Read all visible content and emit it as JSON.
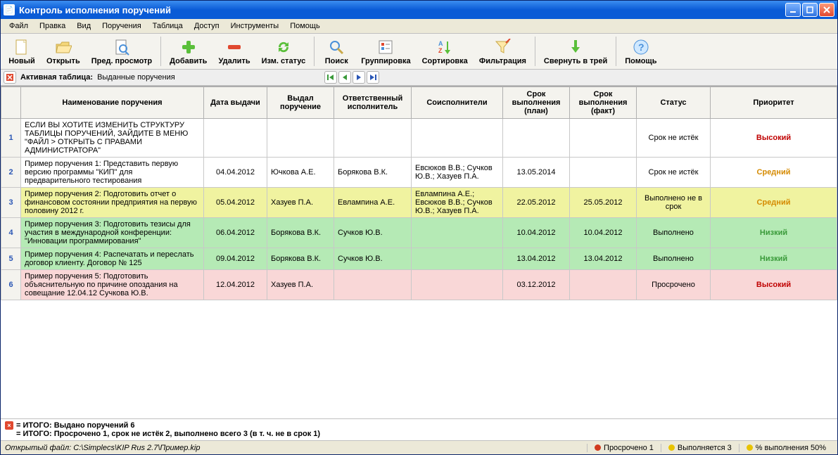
{
  "window": {
    "title": "Контроль исполнения поручений"
  },
  "menu": {
    "file": "Файл",
    "edit": "Правка",
    "view": "Вид",
    "tasks": "Поручения",
    "table": "Таблица",
    "access": "Доступ",
    "tools": "Инструменты",
    "help": "Помощь"
  },
  "toolbar": {
    "new": "Новый",
    "open": "Открыть",
    "preview": "Пред. просмотр",
    "add": "Добавить",
    "delete": "Удалить",
    "status": "Изм. статус",
    "search": "Поиск",
    "group": "Группировка",
    "sort": "Сортировка",
    "filter": "Фильтрация",
    "tray": "Свернуть в трей",
    "help": "Помощь"
  },
  "subbar": {
    "active_table_label": "Активная таблица:",
    "active_table_value": "Выданные поручения"
  },
  "columns": {
    "num": "",
    "name": "Наименование поручения",
    "date": "Дата выдачи",
    "issuer": "Выдал поручение",
    "responsible": "Ответственный исполнитель",
    "co": "Соисполнители",
    "due_plan": "Срок выполнения (план)",
    "due_fact": "Срок выполнения (факт)",
    "status": "Статус",
    "priority": "Приоритет"
  },
  "rows": [
    {
      "num": "1",
      "name": "ЕСЛИ ВЫ ХОТИТЕ ИЗМЕНИТЬ СТРУКТУРУ ТАБЛИЦЫ ПОРУЧЕНИЙ, ЗАЙДИТЕ В МЕНЮ \"ФАЙЛ > ОТКРЫТЬ С ПРАВАМИ АДМИНИСТРАТОРА\"",
      "date": "",
      "issuer": "",
      "responsible": "",
      "co": "",
      "due_plan": "",
      "due_fact": "",
      "status": "Срок не истёк",
      "priority": "Высокий",
      "prio_class": "prio-high",
      "row_class": "dotted-border"
    },
    {
      "num": "2",
      "name": "Пример поручения 1: Представить первую версию программы \"КИП\" для предварительного тестирования",
      "date": "04.04.2012",
      "issuer": "Ючкова А.Е.",
      "responsible": "Борякова В.К.",
      "co": "Евсюков В.В.; Сучков Ю.В.; Хазуев П.А.",
      "due_plan": "13.05.2014",
      "due_fact": "",
      "status": "Срок не истёк",
      "priority": "Средний",
      "prio_class": "prio-med",
      "row_class": ""
    },
    {
      "num": "3",
      "name": "Пример поручения 2: Подготовить отчет о финансовом состоянии предприятия на первую половину 2012 г.",
      "date": "05.04.2012",
      "issuer": "Хазуев П.А.",
      "responsible": "Евлампина А.Е.",
      "co": "Евлампина А.Е.; Евсюков В.В.; Сучков Ю.В.; Хазуев П.А.",
      "due_plan": "22.05.2012",
      "due_fact": "25.05.2012",
      "status": "Выполнено не в срок",
      "priority": "Средний",
      "prio_class": "prio-med",
      "row_class": "row-yellow"
    },
    {
      "num": "4",
      "name": "Пример поручения 3: Подготовить тезисы для участия в международной конференции: \"Инновации программирования\"",
      "date": "06.04.2012",
      "issuer": "Борякова В.К.",
      "responsible": "Сучков Ю.В.",
      "co": "",
      "due_plan": "10.04.2012",
      "due_fact": "10.04.2012",
      "status": "Выполнено",
      "priority": "Низкий",
      "prio_class": "prio-low",
      "row_class": "row-green"
    },
    {
      "num": "5",
      "name": "Пример поручения 4: Распечатать и переслать договор клиенту. Договор № 125",
      "date": "09.04.2012",
      "issuer": "Борякова В.К.",
      "responsible": "Сучков Ю.В.",
      "co": "",
      "due_plan": "13.04.2012",
      "due_fact": "13.04.2012",
      "status": "Выполнено",
      "priority": "Низкий",
      "prio_class": "prio-low",
      "row_class": "row-green"
    },
    {
      "num": "6",
      "name": "Пример поручения 5: Подготовить объяснительную по причине опоздания на совещание 12.04.12 Сучкова Ю.В.",
      "date": "12.04.2012",
      "issuer": "Хазуев П.А.",
      "responsible": "",
      "co": "",
      "due_plan": "03.12.2012",
      "due_fact": "",
      "status": "Просрочено",
      "priority": "Высокий",
      "prio_class": "prio-high",
      "row_class": "row-red"
    }
  ],
  "summary": {
    "line1": "= ИТОГО: Выдано поручений 6",
    "line2": "= ИТОГО: Просрочено 1, срок не истёк 2, выполнено всего 3 (в т. ч. не в срок 1)"
  },
  "statusbar": {
    "open_file": "Открытый файл: C:\\Simplecs\\KIP Rus 2.7\\Пример.kip",
    "overdue": "Просрочено 1",
    "inprogress": "Выполняется 3",
    "percent": "% выполнения 50%"
  }
}
